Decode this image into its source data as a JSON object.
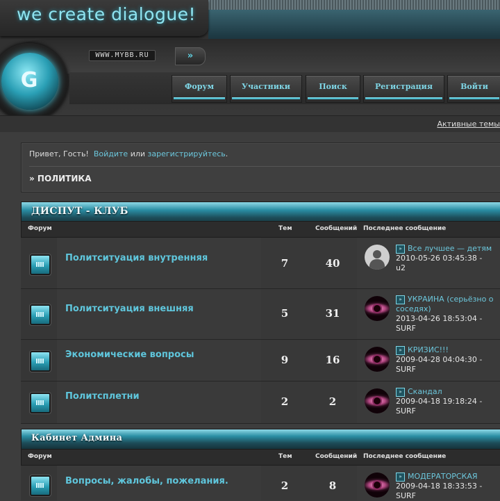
{
  "header": {
    "logo_text": "we create dialogue!",
    "url_text": "WWW.MYBB.RU",
    "go_button": "»",
    "orb_glyph": "G"
  },
  "nav": [
    {
      "label": "Форум"
    },
    {
      "label": "Участники"
    },
    {
      "label": "Поиск"
    },
    {
      "label": "Регистрация"
    },
    {
      "label": "Войти"
    }
  ],
  "subbar": {
    "active_topics": "Активные темы"
  },
  "welcome": {
    "greeting": "Привет, Гость!",
    "login": "Войдите",
    "or": "или",
    "register": "зарегистрируйтесь",
    "period": "."
  },
  "breadcrumb": "» ПОЛИТИКА",
  "columns": {
    "forum": "Форум",
    "topics": "Тем",
    "posts": "Сообщений",
    "last_post": "Последнее сообщение"
  },
  "categories": [
    {
      "title": "ДИСПУТ - КЛУБ",
      "forums": [
        {
          "name": "Политситуация внутренняя",
          "topics": "7",
          "posts": "40",
          "avatar": "person",
          "last_title": "Все лучшее — детям",
          "last_date": "2010-05-26 03:45:38 -",
          "last_user": "u2"
        },
        {
          "name": "Политситуация внешняя",
          "topics": "5",
          "posts": "31",
          "avatar": "eye",
          "last_title": "УКРАИНА (серьёзно о соседях)",
          "last_date": "2013-04-26 18:53:04 -",
          "last_user": "SURF"
        },
        {
          "name": "Экономические вопросы",
          "topics": "9",
          "posts": "16",
          "avatar": "eye",
          "last_title": "КРИЗИС!!!",
          "last_date": "2009-04-28 04:04:30 -",
          "last_user": "SURF"
        },
        {
          "name": "Политсплетни",
          "topics": "2",
          "posts": "2",
          "avatar": "eye",
          "last_title": "Скандал",
          "last_date": "2009-04-18 19:18:24 -",
          "last_user": "SURF"
        }
      ]
    },
    {
      "title": "Кабинет Админа",
      "forums": [
        {
          "name": "Вопросы, жалобы, пожелания.",
          "topics": "2",
          "posts": "8",
          "avatar": "eye",
          "last_title": "МОДЕРАТОРСКАЯ",
          "last_date": "2009-04-18 18:33:53 -",
          "last_user": "SURF"
        }
      ]
    }
  ],
  "colors": {
    "accent": "#5fc6dc",
    "link": "#6cc7dc",
    "background": "#3b3b3b"
  }
}
